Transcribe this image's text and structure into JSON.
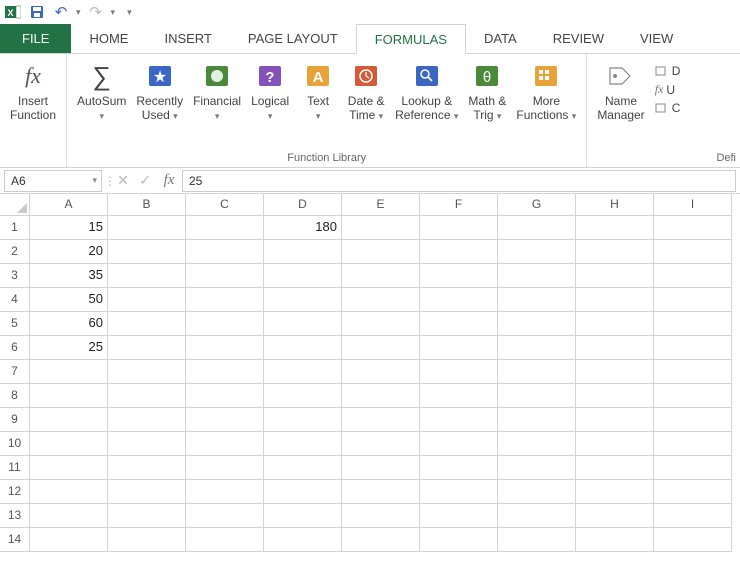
{
  "qat": {
    "undo": "↶",
    "redo": "↷"
  },
  "tabs": {
    "file": "FILE",
    "items": [
      "HOME",
      "INSERT",
      "PAGE LAYOUT",
      "FORMULAS",
      "DATA",
      "REVIEW",
      "VIEW"
    ],
    "active": "FORMULAS"
  },
  "ribbon": {
    "insert_function": {
      "label1": "Insert",
      "label2": "Function"
    },
    "library": {
      "autosum": "AutoSum",
      "recently1": "Recently",
      "recently2": "Used",
      "financial": "Financial",
      "logical": "Logical",
      "text": "Text",
      "datetime1": "Date &",
      "datetime2": "Time",
      "lookup1": "Lookup &",
      "lookup2": "Reference",
      "math1": "Math &",
      "math2": "Trig",
      "more1": "More",
      "more2": "Functions",
      "group_label": "Function Library"
    },
    "names": {
      "name1": "Name",
      "name2": "Manager"
    },
    "clipped": {
      "d": "D",
      "u": "U",
      "c": "C",
      "defi": "Defi"
    }
  },
  "fxbar": {
    "namebox": "A6",
    "formula": "25"
  },
  "grid": {
    "cols": [
      "A",
      "B",
      "C",
      "D",
      "E",
      "F",
      "G",
      "H",
      "I"
    ],
    "rows": [
      "1",
      "2",
      "3",
      "4",
      "5",
      "6",
      "7",
      "8",
      "9",
      "10",
      "11",
      "12",
      "13",
      "14"
    ],
    "cells": {
      "A1": "15",
      "A2": "20",
      "A3": "35",
      "A4": "50",
      "A5": "60",
      "A6": "25",
      "D1": "180"
    }
  }
}
